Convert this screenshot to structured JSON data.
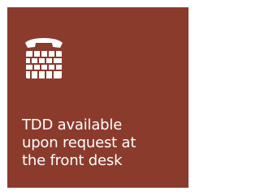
{
  "sign": {
    "background_color": "#8b3b2c",
    "foreground_color": "#ffffff",
    "icon": "tdd-phone-keyboard-icon",
    "caption_lines": [
      "TDD available",
      "upon request at",
      "the front desk"
    ]
  }
}
